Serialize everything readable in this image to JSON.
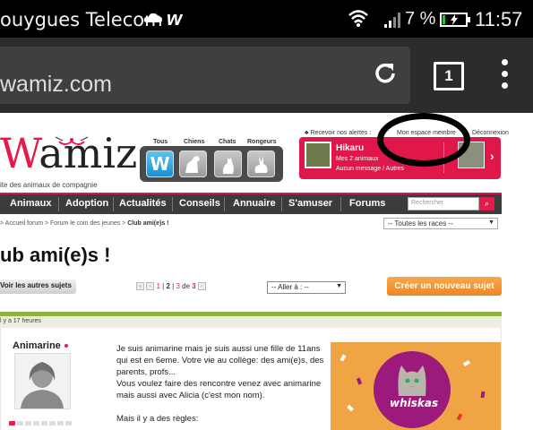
{
  "status_bar": {
    "carrier": "ouygues Telecom",
    "battery_percent": "7 %",
    "time": "11:57",
    "battery_level": 0.07,
    "battery_fill_color": "#2dbd3a"
  },
  "browser": {
    "url": "wamiz.com",
    "tab_count": "1",
    "icons": [
      "reload-icon",
      "tab-switcher-icon",
      "overflow-menu-icon"
    ]
  },
  "site": {
    "logo": "Wamiz",
    "tagline": "ite des animaux de compagnie",
    "species": [
      {
        "label": "Tous",
        "icon": "w-logo-icon"
      },
      {
        "label": "Chiens",
        "icon": "dog-icon"
      },
      {
        "label": "Chats",
        "icon": "cat-icon"
      },
      {
        "label": "Rongeurs",
        "icon": "rabbit-icon"
      }
    ],
    "alerts": "♣ Recevoir nos alertes :",
    "member_space": "Mon espace membre",
    "logout": "Déconnexion",
    "member": {
      "name": "Hikaru",
      "pets": "Mes 2 animaux",
      "messages": "Aucun message / Autres"
    },
    "accent_color": "#e0174a"
  },
  "nav": {
    "items": [
      "Animaux",
      "Adoption",
      "Actualités",
      "Conseils",
      "Annuaire",
      "S'amuser",
      "Forums"
    ],
    "search_placeholder": "Rechercher"
  },
  "breadcrumb": {
    "text": "> Accueil forum > Forum le coin des jeunes > ",
    "current": "Club ami(e)s !"
  },
  "races_select": "-- Toutes les races --",
  "topic": {
    "title": "ub ami(e)s !",
    "other_topics": "Voir les autres sujets",
    "pager": {
      "pages": [
        "1",
        "2",
        "3"
      ],
      "current": "2",
      "of": "de",
      "total": "3"
    },
    "goto": "-- Aller à : --",
    "new_topic": "Créer un nouveau sujet"
  },
  "post": {
    "age": "l y a 17 heures",
    "author": "Animarine",
    "lines": [
      "Je suis animarine mais je suis aussi une fille de 11ans",
      "qui est en 6eme. Votre vie au collège: des ami(e)s, des",
      "parents, profs...",
      "Vous voulez faire des rencontre venez avec animarine",
      "mais aussi avec Alicia (c'est mon nom).",
      "",
      "Mais il y a des règles:"
    ],
    "rank_level": 0.1
  },
  "ad": {
    "brand": "whiskas"
  }
}
